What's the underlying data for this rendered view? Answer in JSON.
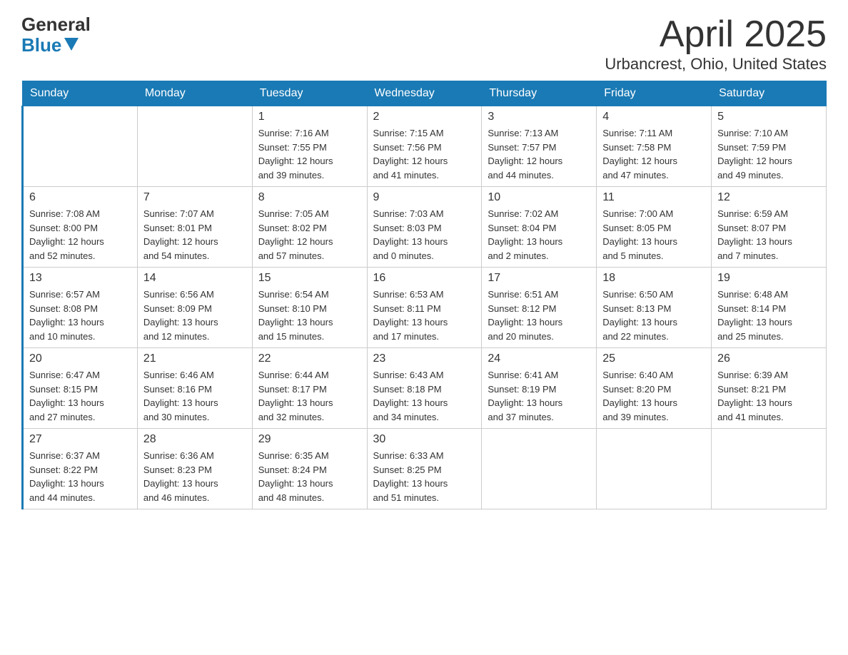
{
  "logo": {
    "general": "General",
    "blue": "Blue"
  },
  "title": "April 2025",
  "subtitle": "Urbancrest, Ohio, United States",
  "days_of_week": [
    "Sunday",
    "Monday",
    "Tuesday",
    "Wednesday",
    "Thursday",
    "Friday",
    "Saturday"
  ],
  "weeks": [
    [
      {
        "day": "",
        "info": ""
      },
      {
        "day": "",
        "info": ""
      },
      {
        "day": "1",
        "info": "Sunrise: 7:16 AM\nSunset: 7:55 PM\nDaylight: 12 hours\nand 39 minutes."
      },
      {
        "day": "2",
        "info": "Sunrise: 7:15 AM\nSunset: 7:56 PM\nDaylight: 12 hours\nand 41 minutes."
      },
      {
        "day": "3",
        "info": "Sunrise: 7:13 AM\nSunset: 7:57 PM\nDaylight: 12 hours\nand 44 minutes."
      },
      {
        "day": "4",
        "info": "Sunrise: 7:11 AM\nSunset: 7:58 PM\nDaylight: 12 hours\nand 47 minutes."
      },
      {
        "day": "5",
        "info": "Sunrise: 7:10 AM\nSunset: 7:59 PM\nDaylight: 12 hours\nand 49 minutes."
      }
    ],
    [
      {
        "day": "6",
        "info": "Sunrise: 7:08 AM\nSunset: 8:00 PM\nDaylight: 12 hours\nand 52 minutes."
      },
      {
        "day": "7",
        "info": "Sunrise: 7:07 AM\nSunset: 8:01 PM\nDaylight: 12 hours\nand 54 minutes."
      },
      {
        "day": "8",
        "info": "Sunrise: 7:05 AM\nSunset: 8:02 PM\nDaylight: 12 hours\nand 57 minutes."
      },
      {
        "day": "9",
        "info": "Sunrise: 7:03 AM\nSunset: 8:03 PM\nDaylight: 13 hours\nand 0 minutes."
      },
      {
        "day": "10",
        "info": "Sunrise: 7:02 AM\nSunset: 8:04 PM\nDaylight: 13 hours\nand 2 minutes."
      },
      {
        "day": "11",
        "info": "Sunrise: 7:00 AM\nSunset: 8:05 PM\nDaylight: 13 hours\nand 5 minutes."
      },
      {
        "day": "12",
        "info": "Sunrise: 6:59 AM\nSunset: 8:07 PM\nDaylight: 13 hours\nand 7 minutes."
      }
    ],
    [
      {
        "day": "13",
        "info": "Sunrise: 6:57 AM\nSunset: 8:08 PM\nDaylight: 13 hours\nand 10 minutes."
      },
      {
        "day": "14",
        "info": "Sunrise: 6:56 AM\nSunset: 8:09 PM\nDaylight: 13 hours\nand 12 minutes."
      },
      {
        "day": "15",
        "info": "Sunrise: 6:54 AM\nSunset: 8:10 PM\nDaylight: 13 hours\nand 15 minutes."
      },
      {
        "day": "16",
        "info": "Sunrise: 6:53 AM\nSunset: 8:11 PM\nDaylight: 13 hours\nand 17 minutes."
      },
      {
        "day": "17",
        "info": "Sunrise: 6:51 AM\nSunset: 8:12 PM\nDaylight: 13 hours\nand 20 minutes."
      },
      {
        "day": "18",
        "info": "Sunrise: 6:50 AM\nSunset: 8:13 PM\nDaylight: 13 hours\nand 22 minutes."
      },
      {
        "day": "19",
        "info": "Sunrise: 6:48 AM\nSunset: 8:14 PM\nDaylight: 13 hours\nand 25 minutes."
      }
    ],
    [
      {
        "day": "20",
        "info": "Sunrise: 6:47 AM\nSunset: 8:15 PM\nDaylight: 13 hours\nand 27 minutes."
      },
      {
        "day": "21",
        "info": "Sunrise: 6:46 AM\nSunset: 8:16 PM\nDaylight: 13 hours\nand 30 minutes."
      },
      {
        "day": "22",
        "info": "Sunrise: 6:44 AM\nSunset: 8:17 PM\nDaylight: 13 hours\nand 32 minutes."
      },
      {
        "day": "23",
        "info": "Sunrise: 6:43 AM\nSunset: 8:18 PM\nDaylight: 13 hours\nand 34 minutes."
      },
      {
        "day": "24",
        "info": "Sunrise: 6:41 AM\nSunset: 8:19 PM\nDaylight: 13 hours\nand 37 minutes."
      },
      {
        "day": "25",
        "info": "Sunrise: 6:40 AM\nSunset: 8:20 PM\nDaylight: 13 hours\nand 39 minutes."
      },
      {
        "day": "26",
        "info": "Sunrise: 6:39 AM\nSunset: 8:21 PM\nDaylight: 13 hours\nand 41 minutes."
      }
    ],
    [
      {
        "day": "27",
        "info": "Sunrise: 6:37 AM\nSunset: 8:22 PM\nDaylight: 13 hours\nand 44 minutes."
      },
      {
        "day": "28",
        "info": "Sunrise: 6:36 AM\nSunset: 8:23 PM\nDaylight: 13 hours\nand 46 minutes."
      },
      {
        "day": "29",
        "info": "Sunrise: 6:35 AM\nSunset: 8:24 PM\nDaylight: 13 hours\nand 48 minutes."
      },
      {
        "day": "30",
        "info": "Sunrise: 6:33 AM\nSunset: 8:25 PM\nDaylight: 13 hours\nand 51 minutes."
      },
      {
        "day": "",
        "info": ""
      },
      {
        "day": "",
        "info": ""
      },
      {
        "day": "",
        "info": ""
      }
    ]
  ]
}
